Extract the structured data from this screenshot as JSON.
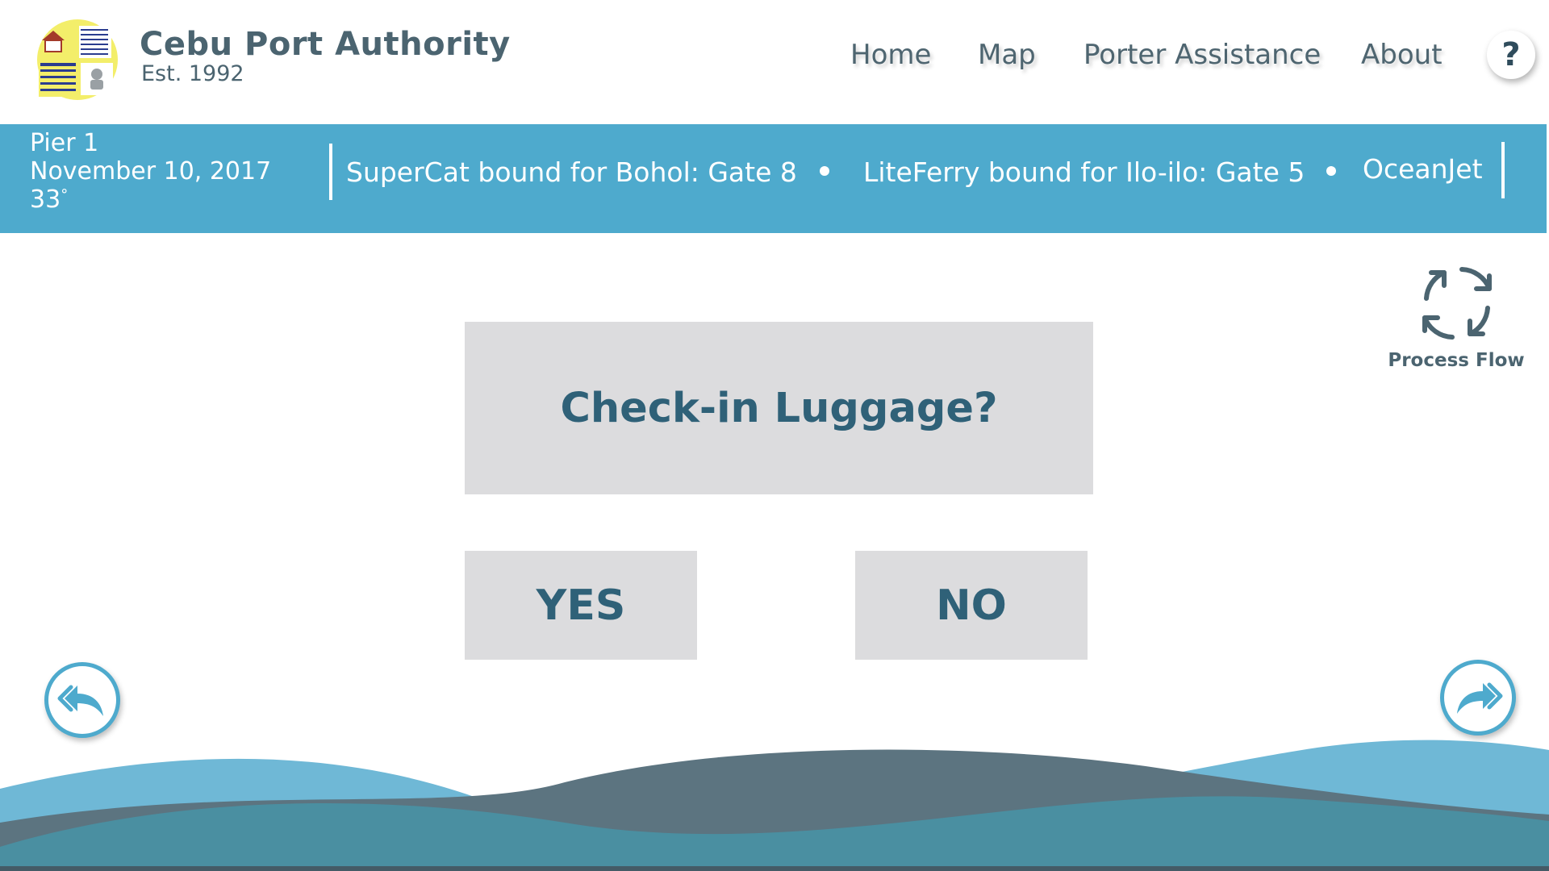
{
  "header": {
    "title": "Cebu Port Authority",
    "subtitle": "Est. 1992",
    "nav": {
      "home": "Home",
      "map": "Map",
      "porter": "Porter Assistance",
      "about": "About"
    },
    "help_label": "?"
  },
  "infobar": {
    "pier": "Pier 1",
    "date": "November 10, 2017",
    "temperature": "33",
    "temperature_unit": "°",
    "ticker": [
      "SuperCat bound for Bohol: Gate 8",
      "LiteFerry bound for Ilo-ilo: Gate 5",
      "OceanJet"
    ]
  },
  "process_flow": {
    "label": "Process Flow",
    "icon": "refresh-cycle-icon"
  },
  "question": {
    "text": "Check-in Luggage?",
    "yes_label": "YES",
    "no_label": "NO"
  },
  "navigation": {
    "back_icon": "reply-back-icon",
    "forward_icon": "forward-icon"
  },
  "colors": {
    "accent": "#4eaacd",
    "text_dark": "#2f6178",
    "panel": "#dcdcde",
    "wave_light": "#6fb8d6",
    "wave_slate": "#5c7480",
    "wave_teal": "#4a8fa1"
  }
}
